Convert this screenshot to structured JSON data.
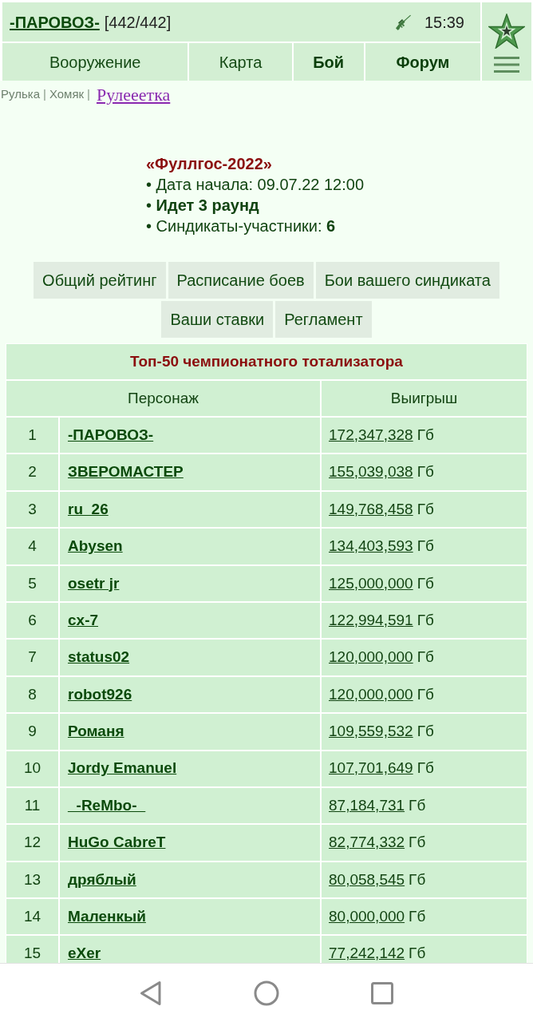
{
  "header": {
    "player": "-ПАРОВОЗ-",
    "hp": "[442/442]",
    "time": "15:39",
    "nav": [
      {
        "label": "Вооружение",
        "bold": false
      },
      {
        "label": "Карта",
        "bold": false
      },
      {
        "label": "Бой",
        "bold": true
      },
      {
        "label": "Форум",
        "bold": true
      }
    ]
  },
  "breadcrumb": {
    "items": [
      {
        "label": "Рулька",
        "separator": "|"
      },
      {
        "label": "Хомяк",
        "separator": "|"
      }
    ],
    "current": "Рулееетка"
  },
  "tournament": {
    "title": "«Фуллгос-2022»",
    "lines": [
      "• Дата начала: 09.07.22 12:00",
      "• **Идет 3 раунд**",
      "• Синдикаты-участники: **6**"
    ]
  },
  "button_rows": [
    [
      "Общий рейтинг",
      "Расписание боев",
      "Бои вашего синдиката"
    ],
    [
      "Ваши ставки",
      "Регламент"
    ]
  ],
  "table": {
    "title": "Топ-50 чемпионатного тотализатора",
    "columns": [
      "Персонаж",
      "Выигрыш"
    ],
    "rows": [
      {
        "rank": "1",
        "name": "-ПАРОВОЗ-",
        "amount": "172,347,328",
        "unit": "Гб"
      },
      {
        "rank": "2",
        "name": "ЗВЕРОМАСТЕР",
        "amount": "155,039,038",
        "unit": "Гб"
      },
      {
        "rank": "3",
        "name": "ru_26",
        "amount": "149,768,458",
        "unit": "Гб"
      },
      {
        "rank": "4",
        "name": "Abysen",
        "amount": "134,403,593",
        "unit": "Гб"
      },
      {
        "rank": "5",
        "name": "osetr jr",
        "amount": "125,000,000",
        "unit": "Гб"
      },
      {
        "rank": "6",
        "name": "cx-7",
        "amount": "122,994,591",
        "unit": "Гб"
      },
      {
        "rank": "7",
        "name": "status02",
        "amount": "120,000,000",
        "unit": "Гб"
      },
      {
        "rank": "8",
        "name": "robot926",
        "amount": "120,000,000",
        "unit": "Гб"
      },
      {
        "rank": "9",
        "name": "Романя",
        "amount": "109,559,532",
        "unit": "Гб"
      },
      {
        "rank": "10",
        "name": "Jordy Emanuel",
        "amount": "107,701,649",
        "unit": "Гб"
      },
      {
        "rank": "11",
        "name": "_-ReMbo-_",
        "amount": "87,184,731",
        "unit": "Гб"
      },
      {
        "rank": "12",
        "name": "HuGo CabreT",
        "amount": "82,774,332",
        "unit": "Гб"
      },
      {
        "rank": "13",
        "name": "дряблый",
        "amount": "80,058,545",
        "unit": "Гб"
      },
      {
        "rank": "14",
        "name": "Маленкый",
        "amount": "80,000,000",
        "unit": "Гб"
      },
      {
        "rank": "15",
        "name": "eXer",
        "amount": "77,242,142",
        "unit": "Гб"
      }
    ]
  }
}
